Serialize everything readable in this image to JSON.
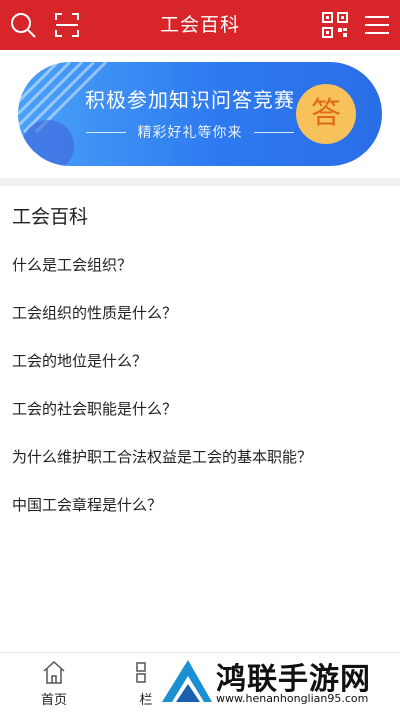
{
  "header": {
    "title": "工会百科",
    "search_icon": "search-icon",
    "scan_icon": "scan-icon",
    "qr_icon": "qrcode-icon",
    "menu_icon": "menu-icon"
  },
  "banner": {
    "headline": "积极参加知识问答竞赛",
    "subline": "精彩好礼等你来",
    "badge": "答"
  },
  "section": {
    "title": "工会百科",
    "questions": [
      "什么是工会组织？",
      "工会组织的性质是什么？",
      "工会的地位是什么？",
      "工会的社会职能是什么？",
      "为什么维护职工合法权益是工会的基本职能？",
      "中国工会章程是什么？"
    ]
  },
  "tabbar": {
    "home_label": "首页",
    "column_label": "栏"
  },
  "watermark": {
    "brand": "鸿联手游网",
    "url": "www.henanhonglian95.com"
  },
  "colors": {
    "header_bg": "#d7252a",
    "banner_blue": "#2d7af0",
    "badge_yellow": "#f7c25b"
  }
}
